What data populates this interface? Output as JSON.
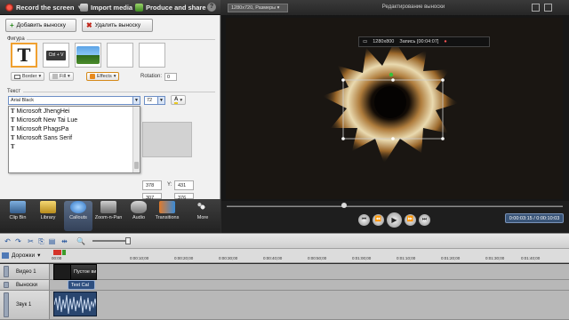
{
  "toolbar": {
    "record_label": "Record the screen",
    "import_label": "Import media",
    "produce_label": "Produce and share",
    "help_label": "?"
  },
  "callout_panel": {
    "add_label": "Добавить выноску",
    "delete_label": "Удалить выноску",
    "shape_heading": "Фигура",
    "key_icon_text": "Ctrl + V",
    "border_label": "Border",
    "fill_label": "Fill",
    "effects_label": "Effects",
    "rotation_label": "Rotation:",
    "rotation_value": "0",
    "text_heading": "Текст",
    "font_value": "Arial Black",
    "font_size_value": "72",
    "font_color_label": "A",
    "font_options": [
      "Microsoft JhengHei",
      "Microsoft New Tai Lue",
      "Microsoft PhagsPa",
      "Microsoft Sans Serif"
    ],
    "pos_x": "378",
    "pos_y_label": "Y:",
    "pos_y": "431",
    "pos_w": "307",
    "pos_h": "376"
  },
  "tasks": [
    {
      "label": "Clip Bin",
      "icon": "film-icon"
    },
    {
      "label": "Library",
      "icon": "folder-icon"
    },
    {
      "label": "Callouts",
      "icon": "speech-bubble-icon"
    },
    {
      "label": "Zoom-n-Pan",
      "icon": "zoom-icon"
    },
    {
      "label": "Audio",
      "icon": "microphone-icon"
    },
    {
      "label": "Transitions",
      "icon": "transitions-icon"
    },
    {
      "label": "More",
      "icon": "more-icon"
    }
  ],
  "preview": {
    "resolution_label": "1280x720, Размеры",
    "title": "Редактирование выноски",
    "rec_size": "1280x800",
    "rec_label": "Запись [00:04:07]",
    "time": "0:00:03:15 / 0:00:10:03"
  },
  "timeline": {
    "tracks_label": "Дорожки",
    "ruler": [
      "00:00",
      "0:00:10;00",
      "0:00:20;00",
      "0:00:30;00",
      "0:00:40;00",
      "0:00:50;00",
      "0:01:00;00",
      "0:01:10;00",
      "0:01:20;00",
      "0:01:30;00",
      "0:01:40;00",
      "0:01:50;00"
    ],
    "tracks": [
      "Видео 1",
      "Выноски",
      "Звук 1"
    ],
    "video_clip_label": "Пустое ви",
    "callout_clip_label": "Text Cal"
  },
  "colors": {
    "accent_orange": "#f0a030",
    "record_red": "#d4342a",
    "time_blue": "#3a5578"
  }
}
